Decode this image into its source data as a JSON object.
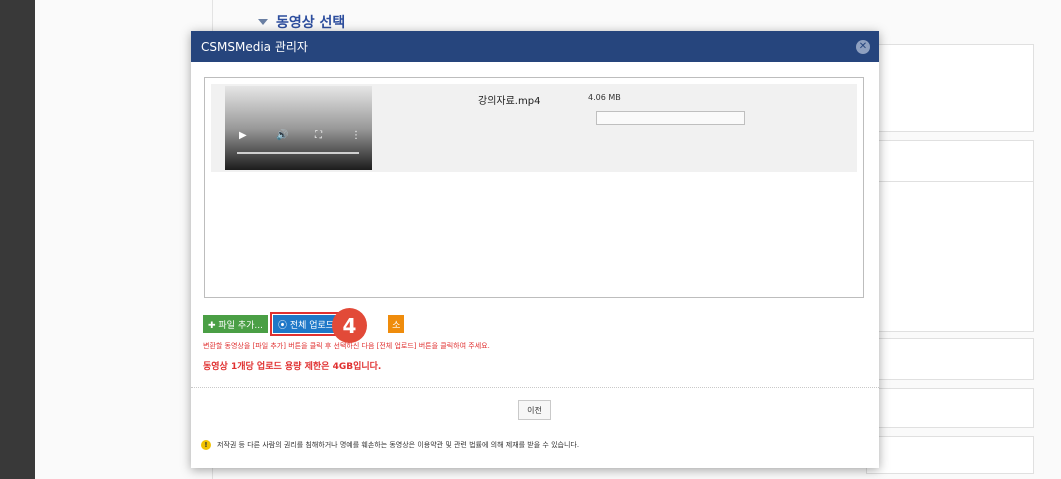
{
  "section": {
    "title": "동영상 선택"
  },
  "modal": {
    "title": "CSMSMedia 관리자",
    "close_icon": "close-icon"
  },
  "file": {
    "name": "강의자료.mp4",
    "size": "4.06 MB"
  },
  "video_controls": {
    "play": "▶",
    "volume": "🔊",
    "fullscreen": "⛶",
    "more": "⋮"
  },
  "buttons": {
    "add_label": "✚ 파일 추가...",
    "upload_label": "⦿ 전체 업로드",
    "cancel_label": "소",
    "prev_label": "이전"
  },
  "step_badge": "4",
  "help": {
    "line1": "변환할 동영상을 [파일 추가] 버튼을 클릭 후 선택하신 다음 [전체 업로드] 버튼을 클릭하여 주세요.",
    "line2": "동영상 1개당 업로드 용량 제한은 4GB입니다."
  },
  "notice": {
    "icon": "!",
    "text": "저작권 등 다른 사람의 권리를 침해하거나 명예를 훼손하는 동영상은 이용약관 및 관련 법률에 의해 제재를 받을 수 있습니다."
  },
  "colors": {
    "header": "#26457d",
    "add": "#4a9f45",
    "upload": "#1e78c8",
    "cancel": "#ef8c0c",
    "badge": "#e24a38",
    "alert": "#e03131"
  }
}
